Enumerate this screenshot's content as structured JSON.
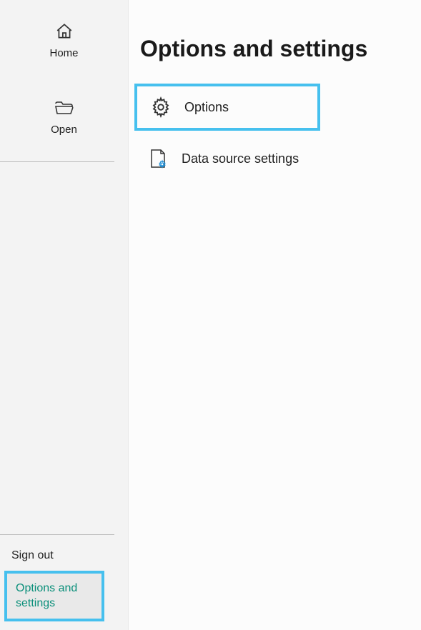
{
  "sidebar": {
    "items": [
      {
        "label": "Home",
        "icon": "home-icon"
      },
      {
        "label": "Open",
        "icon": "folder-open-icon"
      }
    ],
    "bottom": {
      "signOut": "Sign out",
      "optionsSettings": "Options and settings"
    }
  },
  "page": {
    "title": "Options and settings",
    "options": [
      {
        "label": "Options",
        "icon": "gear-icon",
        "highlight": true
      },
      {
        "label": "Data source settings",
        "icon": "data-source-icon",
        "highlight": false
      }
    ]
  },
  "colors": {
    "highlightBorder": "#46c0ee",
    "selectedText": "#0a8f7a"
  }
}
